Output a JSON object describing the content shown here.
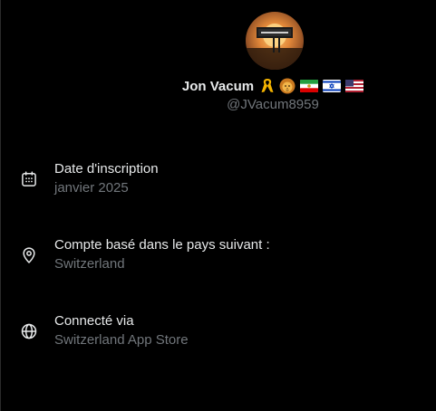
{
  "profile": {
    "display_name": "Jon Vacum",
    "handle": "@JVacum8959",
    "badge_emojis": [
      "yellow-ribbon-icon",
      "lion-icon",
      "iran-flag-icon",
      "israel-flag-icon",
      "usa-flag-icon"
    ]
  },
  "details": [
    {
      "icon": "calendar-icon",
      "label": "Date d'inscription",
      "value": "janvier 2025"
    },
    {
      "icon": "location-pin-icon",
      "label": "Compte basé dans le pays suivant :",
      "value": "Switzerland"
    },
    {
      "icon": "globe-icon",
      "label": "Connecté via",
      "value": "Switzerland App Store"
    }
  ],
  "colors": {
    "background": "#000000",
    "primary_text": "#e7e9ea",
    "secondary_text": "#71767b"
  }
}
